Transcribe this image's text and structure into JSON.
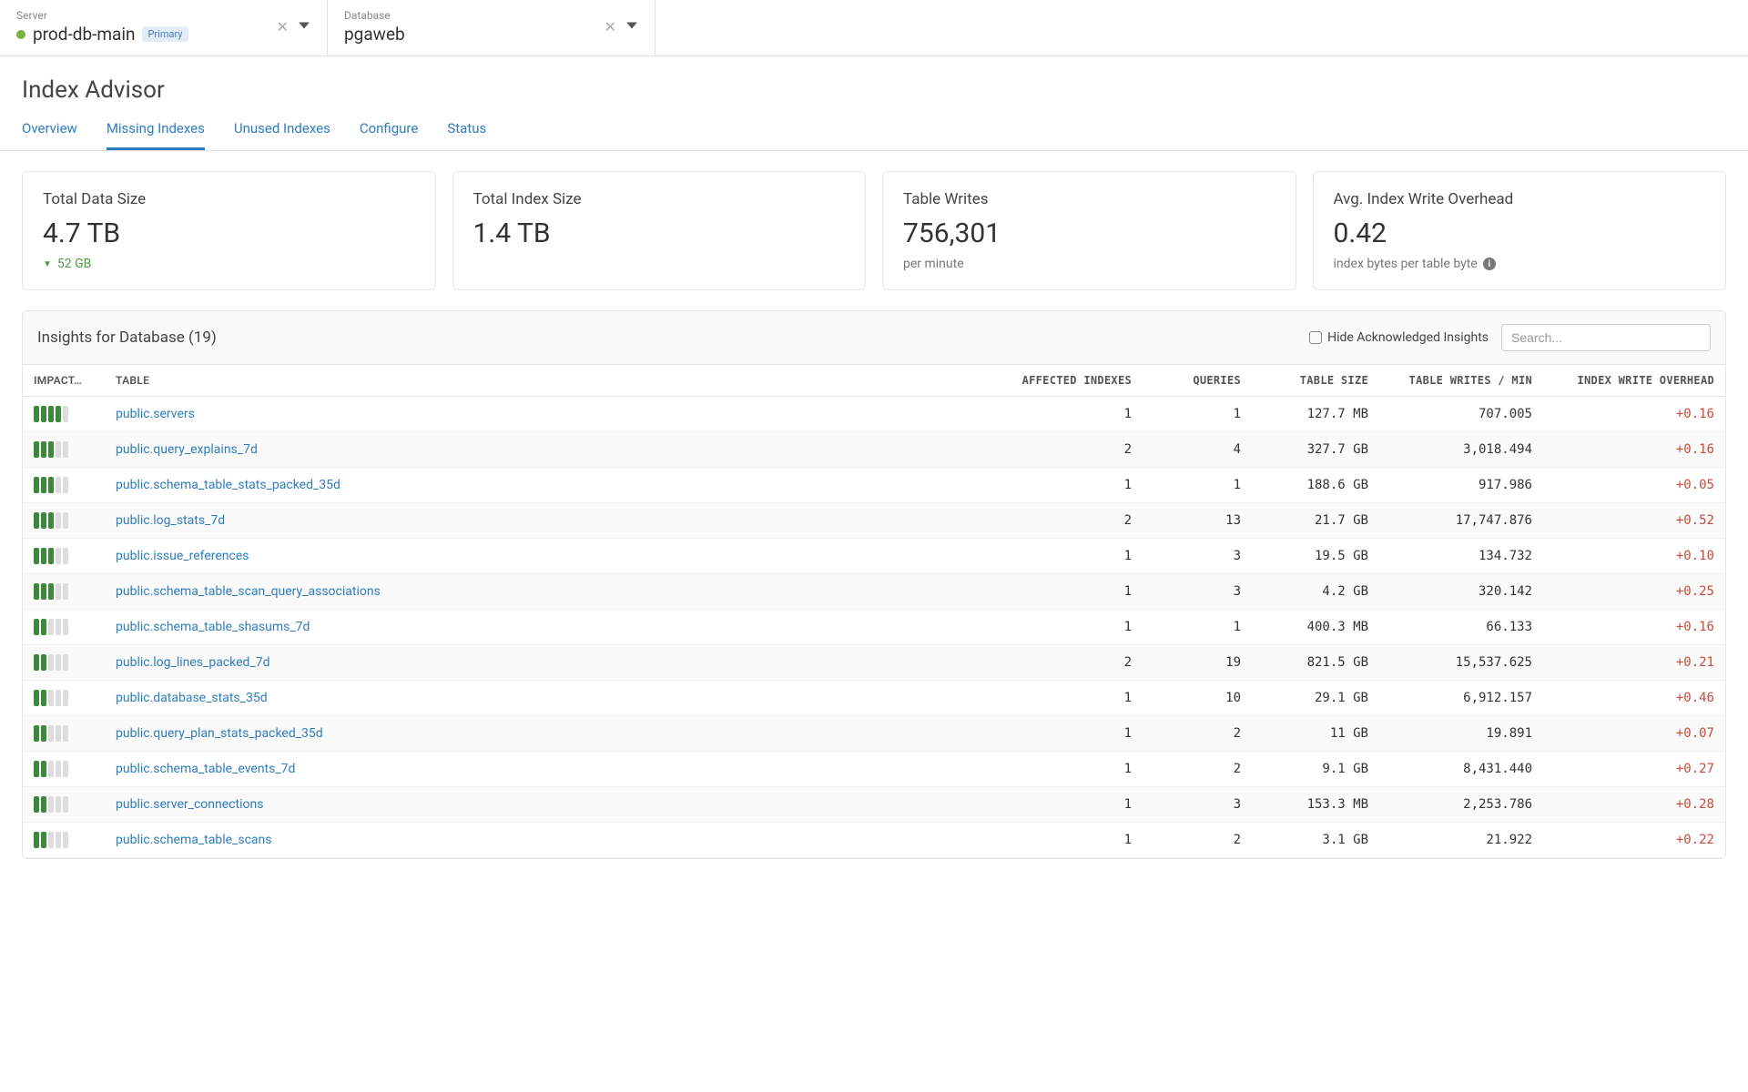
{
  "context": {
    "server_label": "Server",
    "server_value": "prod-db-main",
    "server_tag": "Primary",
    "database_label": "Database",
    "database_value": "pgaweb"
  },
  "page_title": "Index Advisor",
  "tabs": [
    {
      "label": "Overview",
      "active": false
    },
    {
      "label": "Missing Indexes",
      "active": true
    },
    {
      "label": "Unused Indexes",
      "active": false
    },
    {
      "label": "Configure",
      "active": false
    },
    {
      "label": "Status",
      "active": false
    }
  ],
  "stats": [
    {
      "label": "Total Data Size",
      "value": "4.7 TB",
      "sub": "52 GB",
      "sub_type": "delta_down"
    },
    {
      "label": "Total Index Size",
      "value": "1.4 TB",
      "sub": "",
      "sub_type": "none"
    },
    {
      "label": "Table Writes",
      "value": "756,301",
      "sub": "per minute",
      "sub_type": "text"
    },
    {
      "label": "Avg. Index Write Overhead",
      "value": "0.42",
      "sub": "index bytes per table byte",
      "sub_type": "info"
    }
  ],
  "insights": {
    "title": "Insights for Database (19)",
    "hide_label": "Hide Acknowledged Insights",
    "search_placeholder": "Search...",
    "columns": {
      "impact": "IMPACT…",
      "table": "TABLE",
      "affected": "AFFECTED INDEXES",
      "queries": "QUERIES",
      "size": "TABLE SIZE",
      "writes": "TABLE WRITES / MIN",
      "overhead": "INDEX WRITE OVERHEAD"
    },
    "rows": [
      {
        "impact": 4,
        "table": "public.servers",
        "affected": "1",
        "queries": "1",
        "size": "127.7 MB",
        "writes": "707.005",
        "overhead": "+0.16"
      },
      {
        "impact": 3,
        "table": "public.query_explains_7d",
        "affected": "2",
        "queries": "4",
        "size": "327.7 GB",
        "writes": "3,018.494",
        "overhead": "+0.16"
      },
      {
        "impact": 3,
        "table": "public.schema_table_stats_packed_35d",
        "affected": "1",
        "queries": "1",
        "size": "188.6 GB",
        "writes": "917.986",
        "overhead": "+0.05"
      },
      {
        "impact": 3,
        "table": "public.log_stats_7d",
        "affected": "2",
        "queries": "13",
        "size": "21.7 GB",
        "writes": "17,747.876",
        "overhead": "+0.52"
      },
      {
        "impact": 3,
        "table": "public.issue_references",
        "affected": "1",
        "queries": "3",
        "size": "19.5 GB",
        "writes": "134.732",
        "overhead": "+0.10"
      },
      {
        "impact": 3,
        "table": "public.schema_table_scan_query_associations",
        "affected": "1",
        "queries": "3",
        "size": "4.2 GB",
        "writes": "320.142",
        "overhead": "+0.25"
      },
      {
        "impact": 2,
        "table": "public.schema_table_shasums_7d",
        "affected": "1",
        "queries": "1",
        "size": "400.3 MB",
        "writes": "66.133",
        "overhead": "+0.16"
      },
      {
        "impact": 2,
        "table": "public.log_lines_packed_7d",
        "affected": "2",
        "queries": "19",
        "size": "821.5 GB",
        "writes": "15,537.625",
        "overhead": "+0.21"
      },
      {
        "impact": 2,
        "table": "public.database_stats_35d",
        "affected": "1",
        "queries": "10",
        "size": "29.1 GB",
        "writes": "6,912.157",
        "overhead": "+0.46"
      },
      {
        "impact": 2,
        "table": "public.query_plan_stats_packed_35d",
        "affected": "1",
        "queries": "2",
        "size": "11 GB",
        "writes": "19.891",
        "overhead": "+0.07"
      },
      {
        "impact": 2,
        "table": "public.schema_table_events_7d",
        "affected": "1",
        "queries": "2",
        "size": "9.1 GB",
        "writes": "8,431.440",
        "overhead": "+0.27"
      },
      {
        "impact": 2,
        "table": "public.server_connections",
        "affected": "1",
        "queries": "3",
        "size": "153.3 MB",
        "writes": "2,253.786",
        "overhead": "+0.28"
      },
      {
        "impact": 2,
        "table": "public.schema_table_scans",
        "affected": "1",
        "queries": "2",
        "size": "3.1 GB",
        "writes": "21.922",
        "overhead": "+0.22"
      }
    ]
  }
}
